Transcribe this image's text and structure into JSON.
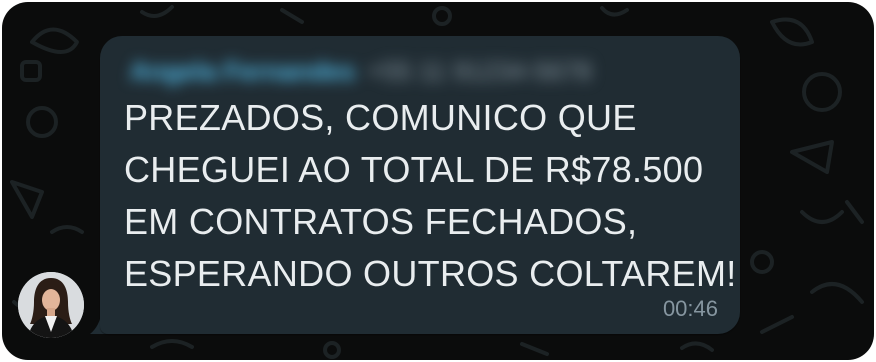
{
  "chat": {
    "message": {
      "sender_name": "Angela Fernandes",
      "sender_phone": "+55 11 91234-5678",
      "lines": [
        "PREZADOS, COMUNICO QUE",
        "CHEGUEI AO TOTAL DE R$78.500",
        "EM CONTRATOS FECHADOS,",
        "ESPERANDO OUTROS COLTAREM!"
      ],
      "time": "00:46",
      "bubble_color": "#202c33",
      "text_color": "#e9edef",
      "sender_color": "#53bdeb",
      "meta_color": "#8696a0"
    },
    "avatar": {
      "icon": "user-photo-icon"
    },
    "wallpaper": {
      "background": "#0b0c0c",
      "doodle_color": "#1b2022"
    }
  }
}
